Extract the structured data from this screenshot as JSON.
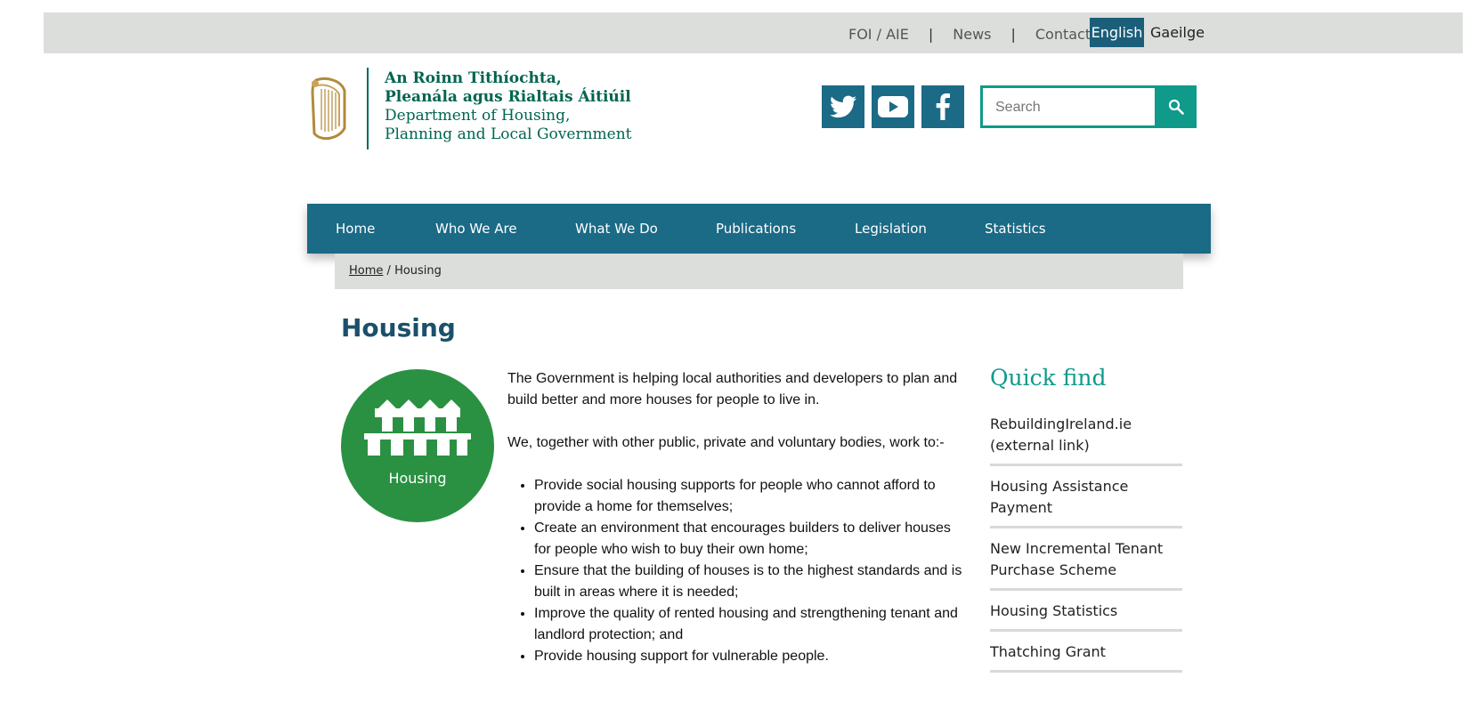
{
  "topbar": {
    "links": [
      "FOI / AIE",
      "News",
      "Contact"
    ],
    "separator": "|",
    "languages": {
      "active": "English",
      "other": "Gaeilge"
    }
  },
  "logo": {
    "ga_line1": "An Roinn Tithíochta,",
    "ga_line2": "Pleanála agus Rialtais Áitiúil",
    "en_line1": "Department of Housing,",
    "en_line2": "Planning and Local Government"
  },
  "social": [
    "twitter-icon",
    "youtube-icon",
    "facebook-icon"
  ],
  "search": {
    "placeholder": "Search"
  },
  "nav": [
    "Home",
    "Who We Are",
    "What We Do",
    "Publications",
    "Legislation",
    "Statistics"
  ],
  "breadcrumb": {
    "home": "Home",
    "separator": "/",
    "current": "Housing"
  },
  "page": {
    "title": "Housing",
    "image_caption": "Housing",
    "intro": "The Government is helping local authorities and developers to plan and build better and more houses for people to live in.",
    "lead": "We, together with other public, private and voluntary bodies, work to:-",
    "bullets": [
      "Provide social housing supports for people who cannot afford to provide a home for themselves;",
      "Create an environment that encourages builders to deliver houses for people  who wish to buy their own home;",
      "Ensure that the building of houses is to the highest standards and is built in areas where it is needed;",
      "Improve the quality of rented housing and strengthening tenant and landlord protection; and",
      "Provide housing support for vulnerable people."
    ]
  },
  "quick_find": {
    "title": "Quick find",
    "items": [
      "RebuildingIreland.ie (external link)",
      "Housing Assistance Payment",
      "New Incremental Tenant Purchase Scheme",
      "Housing Statistics",
      "Thatching Grant"
    ]
  },
  "colors": {
    "nav_bg": "#1b6a86",
    "accent_teal": "#0f9a8a",
    "logo_green": "#00654f",
    "housing_green": "#2a9143",
    "topbar_grey": "#dcdedb"
  }
}
